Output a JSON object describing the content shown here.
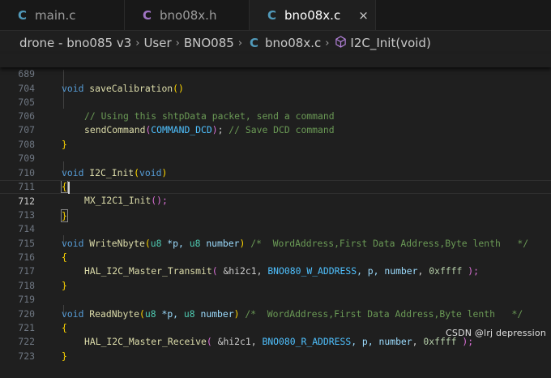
{
  "tabs": [
    {
      "icon": "C",
      "label": "main.c"
    },
    {
      "icon": "C",
      "label": "bno08x.h"
    },
    {
      "icon": "C",
      "label": "bno08x.c",
      "close": "×"
    }
  ],
  "breadcrumb": {
    "project": "drone - bno085 v3",
    "folder1": "User",
    "folder2": "BNO085",
    "file_icon": "C",
    "file": "bno08x.c",
    "symbol": "I2C_Init(void)",
    "sep": "›"
  },
  "colors": {
    "c_icon_header": "#a074c4",
    "c_icon_source": "#519aba",
    "keyword": "#569cd6",
    "function": "#dcdcaa",
    "comment": "#6a9955"
  },
  "editor": {
    "sticky_line": {
      "num": "689",
      "kw": "void",
      "fn": "saveCalibration",
      "paren": "()"
    },
    "lines": [
      {
        "num": "704"
      },
      {
        "num": "705",
        "comment": "// Using this shtpData packet, send a command"
      },
      {
        "num": "706",
        "fn": "sendCommand",
        "open": "(",
        "arg": "COMMAND_DCD",
        "close": ");",
        "comment": " // Save DCD command"
      },
      {
        "num": "707",
        "brace": "}"
      },
      {
        "num": "708"
      },
      {
        "num": "709",
        "kw": "void",
        "fn": "I2C_Init",
        "open": "(",
        "arg": "void",
        "close": ")"
      },
      {
        "num": "710",
        "brace": "{"
      },
      {
        "num": "711",
        "fn": "MX_I2C1_Init",
        "call": "();"
      },
      {
        "num": "712",
        "brace": "}"
      },
      {
        "num": "713"
      },
      {
        "num": "714",
        "kw": "void",
        "fn": "WriteNbyte",
        "open": "(",
        "t1": "u8",
        "p1": " *p, ",
        "t2": "u8",
        "p2": "number",
        "close": ")",
        "comment": " /*  WordAddress,First Data Address,Byte lenth   */"
      },
      {
        "num": "715",
        "brace": "{"
      },
      {
        "num": "716",
        "fn": "HAL_I2C_Master_Transmit",
        "open": "(",
        "a1": " &hi2c1, ",
        "mac": "BNO080_W_ADDRESS",
        "a2": ", p, ",
        "a3": "number",
        "a4": ", ",
        "n": "0xffff",
        "close": " );"
      },
      {
        "num": "717",
        "brace": "}"
      },
      {
        "num": "718"
      },
      {
        "num": "719",
        "kw": "void",
        "fn": "ReadNbyte",
        "open": "(",
        "t1": "u8",
        "p1": " *p, ",
        "t2": "u8",
        "p2": "number",
        "close": ")",
        "comment": " /*  WordAddress,First Data Address,Byte lenth   */"
      },
      {
        "num": "720",
        "brace": "{"
      },
      {
        "num": "721",
        "fn": "HAL_I2C_Master_Receive",
        "open": "(",
        "a1": " &hi2c1, ",
        "mac": "BNO080_R_ADDRESS",
        "a2": ", p, ",
        "a3": "number",
        "a4": ", ",
        "n": "0xffff",
        "close": " );"
      },
      {
        "num": "722",
        "brace": "}"
      },
      {
        "num": "723"
      }
    ]
  },
  "watermark": "CSDN @lrj  depression"
}
